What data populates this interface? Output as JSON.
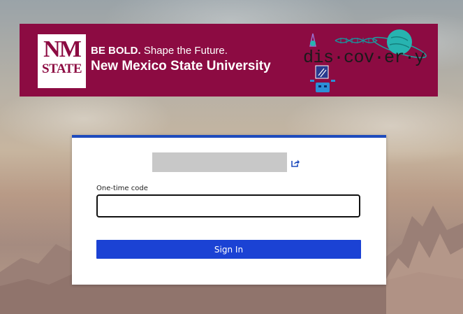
{
  "banner": {
    "logo_nm": "NM",
    "logo_state": "STATE",
    "tagline_bold": "BE BOLD.",
    "tagline_rest": " Shape the Future.",
    "university": "New Mexico State University",
    "discovery": "dis·cov·er·y"
  },
  "login": {
    "username_value": "",
    "code_label": "One-time code",
    "code_value": "",
    "signin_label": "Sign In"
  },
  "colors": {
    "banner_bg": "#8c0b42",
    "card_top_border": "#1e4bbd",
    "signin_bg": "#1b42d4"
  }
}
